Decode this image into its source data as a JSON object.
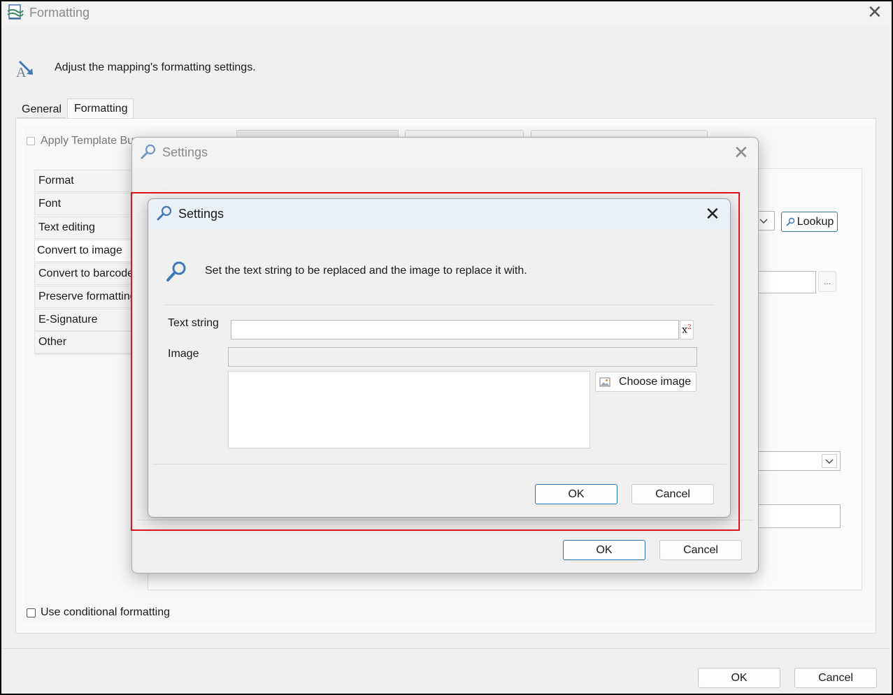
{
  "main_window": {
    "title": "Formatting",
    "description": "Adjust the mapping's formatting settings.",
    "tabs": [
      {
        "label": "General"
      },
      {
        "label": "Formatting"
      }
    ],
    "apply_template": "Apply Template Bu",
    "nav_items": [
      {
        "label": "Format"
      },
      {
        "label": "Font"
      },
      {
        "label": "Text editing"
      },
      {
        "label": "Convert to image"
      },
      {
        "label": "Convert to barcode"
      },
      {
        "label": "Preserve formatting"
      },
      {
        "label": "E-Signature"
      },
      {
        "label": "Other"
      }
    ],
    "lookup_label": "Lookup",
    "ellipsis_label": "...",
    "use_conditional_formatting": "Use conditional formatting",
    "ok_label": "OK",
    "cancel_label": "Cancel"
  },
  "back_dialog": {
    "title": "Settings",
    "ok_label": "OK",
    "cancel_label": "Cancel"
  },
  "front_dialog": {
    "title": "Settings",
    "description": "Set the text string to be replaced and the image to replace it with.",
    "text_string_label": "Text string",
    "text_string_value": "",
    "image_label": "Image",
    "image_path_value": "",
    "choose_image_label": "Choose image",
    "ok_label": "OK",
    "cancel_label": "Cancel"
  },
  "colors": {
    "highlight_border": "#d9141b",
    "primary_border": "#2a72b5",
    "icon_blue": "#3f78b8"
  }
}
